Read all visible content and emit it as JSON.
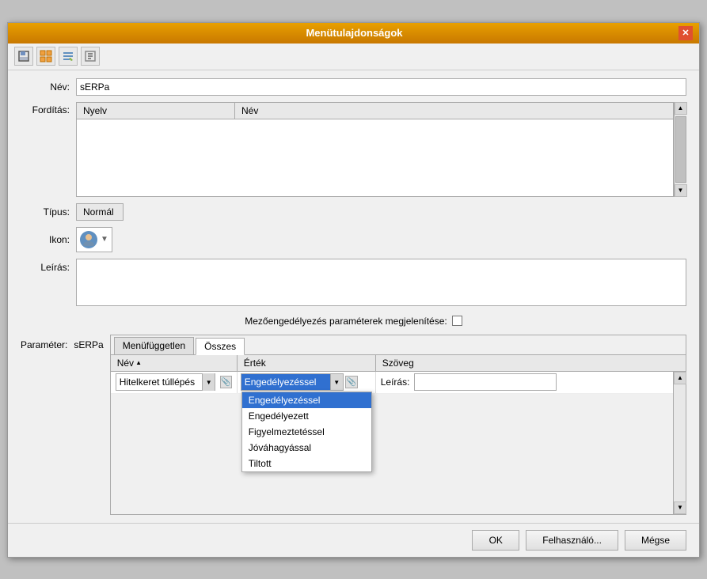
{
  "window": {
    "title": "Menütulajdonságok",
    "close_label": "✕"
  },
  "toolbar": {
    "btn1": "🖫",
    "btn2": "⊞",
    "btn3": "✎",
    "btn4": "📋"
  },
  "form": {
    "nev_label": "Név:",
    "nev_value": "sERPa",
    "forditas_label": "Fordítás:",
    "forditas_col1": "Nyelv",
    "forditas_col2": "Név",
    "tipus_label": "Típus:",
    "tipus_value": "Normál",
    "ikon_label": "Ikon:",
    "leiras_label": "Leírás:",
    "mezoe_label": "Mezőengedélyezés paraméterek megjelenítése:",
    "parameter_label": "Paraméter:",
    "parameter_value": "sERPa"
  },
  "tabs": [
    {
      "label": "Menüfüggetlen",
      "active": false
    },
    {
      "label": "Összes",
      "active": true
    }
  ],
  "table": {
    "col_nev": "Név",
    "col_ertek": "Érték",
    "col_szoveg": "Szöveg"
  },
  "param_row": {
    "name": "Hitelkeret túllépés",
    "value_selected": "Engedélyezéssel"
  },
  "dropdown": {
    "options": [
      {
        "label": "Engedélyezéssel",
        "selected": true
      },
      {
        "label": "Engedélyezett",
        "selected": false
      },
      {
        "label": "Figyelmeztetéssel",
        "selected": false
      },
      {
        "label": "Jóváhagyással",
        "selected": false
      },
      {
        "label": "Tiltott",
        "selected": false
      }
    ]
  },
  "leiras_section": {
    "label": "Leírás:",
    "value": ""
  },
  "buttons": {
    "ok": "OK",
    "felhasznalo": "Felhasználó...",
    "megse": "Mégse"
  }
}
